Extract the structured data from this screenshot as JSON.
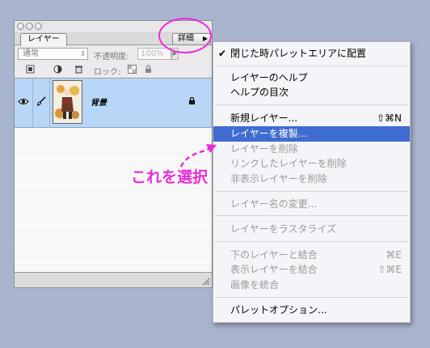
{
  "palette": {
    "tab_label": "レイヤー",
    "detail_button": "詳細",
    "blend_mode": "通常",
    "opacity_label": "不透明度:",
    "opacity_value": "100%",
    "lock_label": "ロック:",
    "layers": [
      {
        "name": "背景",
        "visible": true,
        "selected": true,
        "locked": true
      }
    ]
  },
  "menu": {
    "items": [
      {
        "label": "閉じた時パレットエリアに配置",
        "checked": true,
        "enabled": true
      },
      {
        "separator": true
      },
      {
        "label": "レイヤーのヘルプ",
        "enabled": true
      },
      {
        "label": "ヘルプの目次",
        "enabled": true
      },
      {
        "separator": true
      },
      {
        "label": "新規レイヤー...",
        "shortcut": "⇧⌘N",
        "enabled": true
      },
      {
        "label": "レイヤーを複製...",
        "enabled": true,
        "selected": true
      },
      {
        "label": "レイヤーを削除",
        "enabled": false
      },
      {
        "label": "リンクしたレイヤーを削除",
        "enabled": false
      },
      {
        "label": "非表示レイヤーを削除",
        "enabled": false
      },
      {
        "separator": true
      },
      {
        "label": "レイヤー名の変更...",
        "enabled": false
      },
      {
        "separator": true
      },
      {
        "label": "レイヤーをラスタライズ",
        "enabled": false
      },
      {
        "separator": true
      },
      {
        "label": "下のレイヤーと結合",
        "shortcut": "⌘E",
        "enabled": false
      },
      {
        "label": "表示レイヤーを結合",
        "shortcut": "⇧⌘E",
        "enabled": false
      },
      {
        "label": "画像を統合",
        "enabled": false
      },
      {
        "separator": true
      },
      {
        "label": "パレットオプション...",
        "enabled": true
      }
    ]
  },
  "annotation": {
    "text": "これを選択",
    "color": "#e92cd8"
  },
  "colors": {
    "selection": "#3e6cd0",
    "layer_selected": "#b7d6f8",
    "highlight": "#ee28de"
  }
}
